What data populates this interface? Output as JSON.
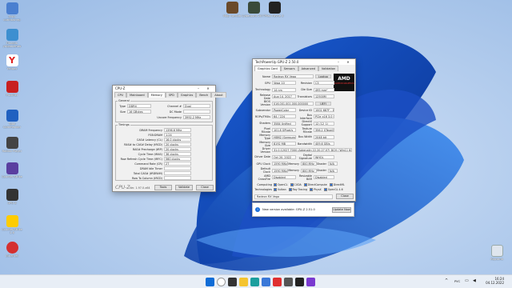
{
  "desktop_left": [
    {
      "label": "Этот компьютер",
      "color": "#4a7fd0"
    },
    {
      "label": "Панель управления",
      "color": "#3d8fd0"
    },
    {
      "label": "Yandex",
      "color": "#ffffff",
      "glyph": "Y"
    },
    {
      "label": "Proxifier",
      "color": "#c82020"
    },
    {
      "label": "Total Commander",
      "color": "#2060c0"
    },
    {
      "label": "Roblox Player",
      "color": "#444"
    },
    {
      "label": "Counter-Strike",
      "color": "#5a3fa0"
    },
    {
      "label": "GPU-Z",
      "color": "#333"
    },
    {
      "label": "Counter-Strike 1.6",
      "color": "#ffcc00"
    },
    {
      "label": "Ethernet",
      "color": "#d43030"
    }
  ],
  "desktop_top": [
    {
      "label": "Мир танков",
      "color": "#6a4a2a"
    },
    {
      "label": "Cyberpunk 2077",
      "color": "#3a4a3a"
    },
    {
      "label": "Max Payne 3",
      "color": "#222"
    }
  ],
  "recycle_bin": "Корзина",
  "cpuz": {
    "title": "CPU-Z",
    "tabs": [
      "CPU",
      "Mainboard",
      "Memory",
      "SPD",
      "Graphics",
      "Bench",
      "About"
    ],
    "active_tab": "Memory",
    "general_label": "General",
    "type_label": "Type",
    "type_value": "DDR4",
    "size_label": "Size",
    "size_value": "16 GBytes",
    "channel_label": "Channel #",
    "channel_value": "Dual",
    "dcmode_label": "DC Mode",
    "dcmode_value": "",
    "uncore_label": "Uncore Frequency",
    "uncore_value": "3992.2 MHz",
    "timings_label": "Timings",
    "timings": [
      {
        "k": "DRAM Frequency",
        "v": "1396.6 MHz"
      },
      {
        "k": "FSB:DRAM",
        "v": "1:24"
      },
      {
        "k": "CAS# Latency (CL)",
        "v": "16.0 clocks"
      },
      {
        "k": "RAS# to CAS# Delay (tRCD)",
        "v": "20 clocks"
      },
      {
        "k": "RAS# Precharge (tRP)",
        "v": "20 clocks"
      },
      {
        "k": "Cycle Time (tRAS)",
        "v": "36 clocks"
      },
      {
        "k": "Row Refresh Cycle Time (tRFC)",
        "v": "560 clocks"
      },
      {
        "k": "Command Rate (CR)",
        "v": "2T"
      },
      {
        "k": "DRAM Idle Timer",
        "v": ""
      },
      {
        "k": "Total CAS# (tRDRAM)",
        "v": ""
      },
      {
        "k": "Row To Column (tRCD)",
        "v": ""
      }
    ],
    "brand": "CPU-Z",
    "version": "Ver. 1.97.0.x64",
    "tools": "Tools",
    "validate": "Validate",
    "close": "Close"
  },
  "gpuz": {
    "title": "TechPowerUp GPU-Z 2.50.0",
    "tabs": [
      "Graphics Card",
      "Sensors",
      "Advanced",
      "Validation"
    ],
    "rows": [
      {
        "k": "Name",
        "v": "Radeon RX Vega",
        "extra": "Lookup"
      },
      {
        "k": "GPU",
        "v": "Vega 10",
        "k2": "Revision",
        "v2": "C3"
      },
      {
        "k": "Technology",
        "v": "14 nm",
        "k2": "Die Size",
        "v2": "495 mm²"
      },
      {
        "k": "Release Date",
        "v": "Aug 14, 2017",
        "k2": "Transistors",
        "v2": "12500M"
      },
      {
        "k": "BIOS Version",
        "v": "016.001.001.000.000000",
        "extra": "UEFI"
      },
      {
        "k": "Subvendor",
        "v": "PowerColor",
        "k2": "Device ID",
        "v2": "1002 687F - 148C 2388"
      },
      {
        "k": "ROPs/TMUs",
        "v": "64 / 224",
        "k2": "Bus Interface",
        "v2": "PCIe x16 3.0 @ x16 3.0"
      },
      {
        "k": "Shaders",
        "v": "3584 Unified",
        "k2": "DirectX Support",
        "v2": "12 (12_1)"
      },
      {
        "k": "Pixel Fillrate",
        "v": "101.8 GPixel/s",
        "k2": "Texture Fillrate",
        "v2": "356.2 GTexel/s"
      },
      {
        "k": "Memory Type",
        "v": "HBM2 (Samsung)",
        "k2": "Bus Width",
        "v2": "2048 bit"
      },
      {
        "k": "Memory Size",
        "v": "8192 MB",
        "k2": "Bandwidth",
        "v2": "409.6 GB/s"
      },
      {
        "k": "Driver Version",
        "v": "31.0.12027.7000 (Adrenalin 22.20.27.07) DCH / Win11 64"
      },
      {
        "k": "Driver Date",
        "v": "Oct 20, 2022",
        "k2": "Digital Signature",
        "v2": "WHQL"
      },
      {
        "k": "GPU Clock",
        "v": "1590 MHz",
        "k2": "Memory",
        "v2": "800 MHz",
        "k3": "Shader",
        "v3": "N/A"
      },
      {
        "k": "Default Clock",
        "v": "1590 MHz",
        "k2": "Memory",
        "v2": "800 MHz",
        "k3": "Shader",
        "v3": "N/A"
      },
      {
        "k": "AMD CrossFire",
        "v": "Disabled",
        "k2": "Resizable BAR",
        "v2": "Disabled"
      }
    ],
    "computing_label": "Computing",
    "computing": [
      "OpenCL",
      "CUDA",
      "DirectCompute",
      "DirectML"
    ],
    "technologies_label": "Technologies",
    "technologies": [
      "Vulkan",
      "Ray Tracing",
      "PhysX",
      "OpenGL 4.6"
    ],
    "selected_card": "Radeon RX Vega",
    "close": "Close",
    "logo_top": "AMD",
    "logo_bottom": "RADEON GRAPHICS"
  },
  "update_bar": {
    "text": "New version available: GPU-Z 2.51.0",
    "button": "Update Now"
  },
  "tray": {
    "lang": "РУС",
    "time": "16:24",
    "date": "04.12.2022"
  }
}
